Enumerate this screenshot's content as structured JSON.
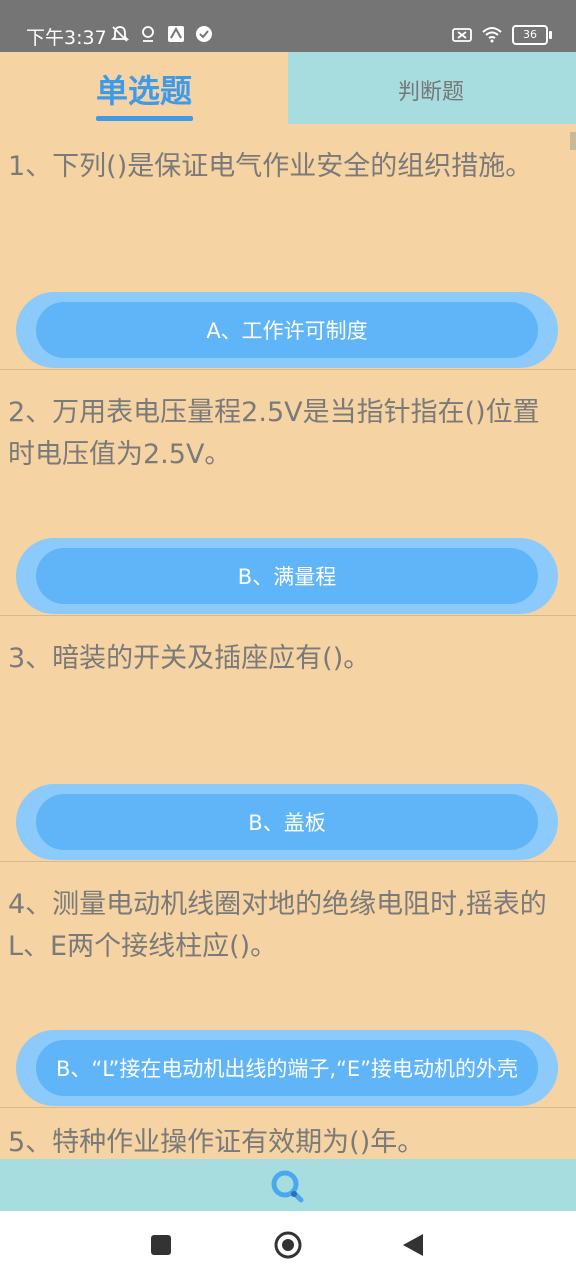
{
  "status_bar": {
    "time": "下午3:37",
    "battery": "36"
  },
  "tabs": {
    "single": "单选题",
    "judge": "判断题"
  },
  "questions": [
    {
      "text": "1、下列()是保证电气作业安全的组织措施。",
      "answer": "A、工作许可制度"
    },
    {
      "text": "2、万用表电压量程2.5V是当指针指在()位置时电压值为2.5V。",
      "answer": "B、满量程"
    },
    {
      "text": "3、暗装的开关及插座应有()。",
      "answer": "B、盖板"
    },
    {
      "text": "4、测量电动机线圈对地的绝缘电阻时,摇表的L、E两个接线柱应()。",
      "answer": "B、“L”接在电动机出线的端子,“E”接电动机的外壳"
    },
    {
      "text": "5、特种作业操作证有效期为()年。"
    }
  ],
  "colors": {
    "accent": "#3f9bea",
    "page_bg": "#f5d3a3",
    "tab_bg": "#a8dde0",
    "answer_bg": "#5fb5f7"
  }
}
